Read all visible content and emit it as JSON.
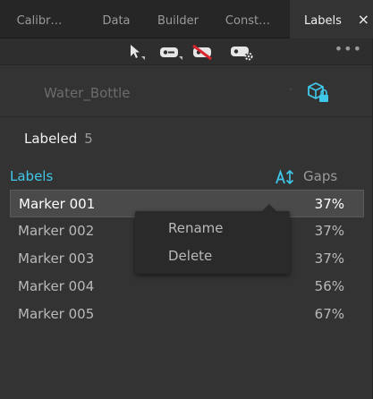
{
  "tabs": [
    {
      "label": "Calibr…",
      "active": false
    },
    {
      "label": "Data",
      "active": false
    },
    {
      "label": "Builder",
      "active": false
    },
    {
      "label": "Const…",
      "active": false
    },
    {
      "label": "Labels",
      "active": true
    }
  ],
  "tab_close_glyph": "×",
  "toolbar": {
    "icons": [
      "pointer-tool-icon",
      "marker-tool-icon",
      "hide-markers-icon",
      "settings-tool-icon"
    ],
    "more_glyph": "•••"
  },
  "asset": {
    "selected": "Water_Bottle",
    "caret": "˅",
    "lock_icon": "cube-lock-icon"
  },
  "labeled": {
    "label": "Labeled",
    "count": "5"
  },
  "labels_header": {
    "title": "Labels",
    "sort_icon": "sort-icon",
    "gaps_label": "Gaps"
  },
  "markers": [
    {
      "name": "Marker 001",
      "gaps": "37%",
      "selected": true
    },
    {
      "name": "Marker 002",
      "gaps": "37%",
      "selected": false
    },
    {
      "name": "Marker 003",
      "gaps": "37%",
      "selected": false
    },
    {
      "name": "Marker 004",
      "gaps": "56%",
      "selected": false
    },
    {
      "name": "Marker 005",
      "gaps": "67%",
      "selected": false
    }
  ],
  "context_menu": {
    "items": [
      "Rename",
      "Delete"
    ]
  },
  "colors": {
    "accent": "#3fc8ea",
    "panel_bg": "#333333",
    "tab_bg": "#262626",
    "selected_row": "#4a4a4a",
    "hide_icon_red": "#d9262c"
  }
}
